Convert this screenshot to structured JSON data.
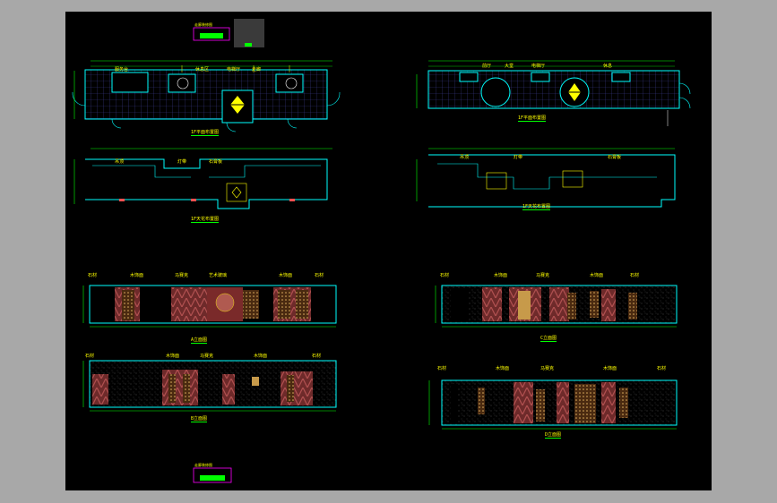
{
  "window": {
    "title": "",
    "background": "#a8a8a8",
    "sheet_color": "#000000"
  },
  "colors": {
    "wall": "#00ffff",
    "dim": "#00ff00",
    "text": "#ffff00",
    "panel": "#8b3a3a",
    "accent": "#ff00ff",
    "grid": "#2a2a66",
    "wood": "#c79a4a"
  },
  "plans": [
    {
      "id": "floor-plan-left",
      "caption": "1F平面布置图",
      "labels": [
        "服务台",
        "休息区",
        "电梯厅",
        "走廊"
      ]
    },
    {
      "id": "floor-plan-right",
      "caption": "1F平面布置图",
      "labels": [
        "前厅",
        "大堂",
        "电梯厅",
        "休息"
      ]
    },
    {
      "id": "ceiling-plan-left",
      "caption": "1F天花布置图",
      "labels": [
        "吊顶",
        "灯带",
        "石膏板"
      ]
    },
    {
      "id": "ceiling-plan-right",
      "caption": "1F天花布置图",
      "labels": [
        "吊顶",
        "灯带",
        "石膏板"
      ]
    }
  ],
  "elevations": [
    {
      "id": "elevation-a",
      "caption": "A立面图",
      "labels": [
        "石材",
        "木饰面",
        "马赛克",
        "艺术玻璃",
        "木饰面",
        "石材"
      ]
    },
    {
      "id": "elevation-b",
      "caption": "B立面图",
      "labels": [
        "石材",
        "木饰面",
        "马赛克",
        "木饰面",
        "石材"
      ]
    },
    {
      "id": "elevation-c",
      "caption": "C立面图",
      "labels": [
        "石材",
        "木饰面",
        "马赛克",
        "木饰面",
        "石材"
      ]
    },
    {
      "id": "elevation-d",
      "caption": "D立面图",
      "labels": [
        "石材",
        "木饰面",
        "马赛克",
        "木饰面",
        "石材"
      ]
    }
  ],
  "title_blocks": [
    {
      "id": "title-block-top",
      "text": "走廊装修图"
    },
    {
      "id": "title-block-bottom",
      "text": "走廊装修图"
    }
  ]
}
